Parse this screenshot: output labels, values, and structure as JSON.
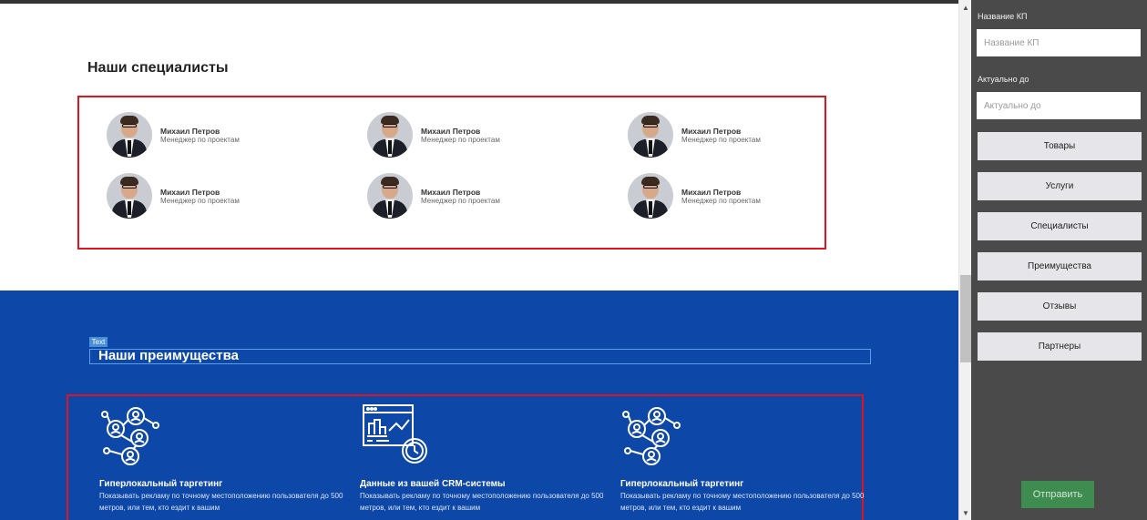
{
  "specialists": {
    "title": "Наши специалисты",
    "items": [
      {
        "name": "Михаил Петров",
        "role": "Менеджер по проектам"
      },
      {
        "name": "Михаил Петров",
        "role": "Менеджер по проектам"
      },
      {
        "name": "Михаил Петров",
        "role": "Менеджер по проектам"
      },
      {
        "name": "Михаил Петров",
        "role": "Менеджер по проектам"
      },
      {
        "name": "Михаил Петров",
        "role": "Менеджер по проектам"
      },
      {
        "name": "Михаил Петров",
        "role": "Менеджер по проектам"
      }
    ]
  },
  "advantages": {
    "tag": "Text",
    "title": "Наши преимущества",
    "items": [
      {
        "icon": "network-users-icon",
        "heading": "Гиперлокальный таргетинг",
        "desc": "Показывать рекламу по точному местоположению пользователя до 500 метров, или тем, кто ездит к вашим"
      },
      {
        "icon": "crm-analytics-icon",
        "heading": "Данные из вашей CRM-системы",
        "desc": "Показывать рекламу по точному местоположению пользователя до 500 метров, или тем, кто ездит к вашим"
      },
      {
        "icon": "network-users-icon",
        "heading": "Гиперлокальный таргетинг",
        "desc": "Показывать рекламу по точному местоположению пользователя до 500 метров, или тем, кто ездит к вашим"
      }
    ]
  },
  "sidebar": {
    "name_label": "Название КП",
    "name_placeholder": "Название КП",
    "valid_label": "Актуально до",
    "valid_placeholder": "Актуально до",
    "buttons": [
      "Товары",
      "Услуги",
      "Специалисты",
      "Преимущества",
      "Отзывы",
      "Партнеры"
    ],
    "submit": "Отправить"
  },
  "colors": {
    "accent_blue": "#0d47a8",
    "selection_red": "#e0141e",
    "sidebar_bg": "#4a4a4a",
    "submit_green": "#3e8c4f"
  }
}
